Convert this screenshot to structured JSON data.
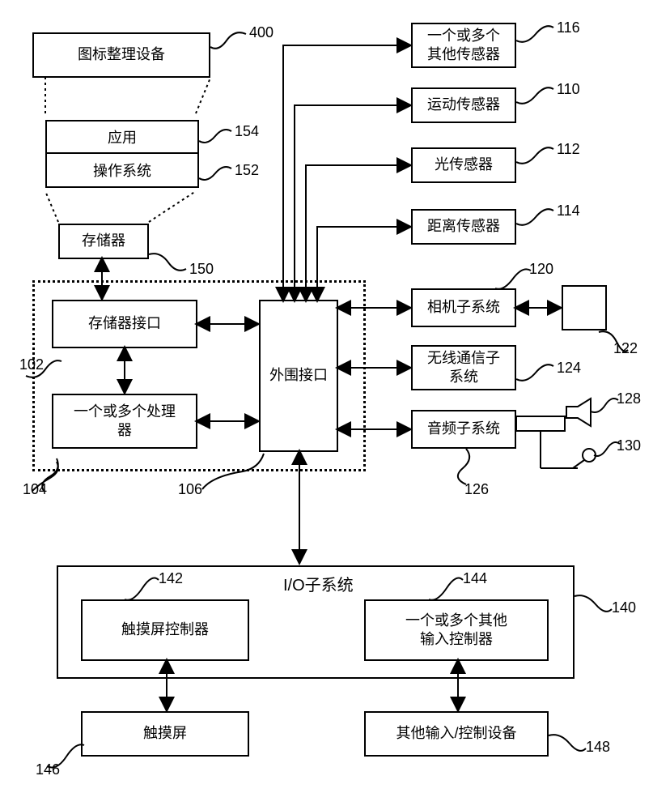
{
  "blocks": {
    "icon_organizer": {
      "label": "图标整理设备",
      "ref": "400"
    },
    "application": {
      "label": "应用",
      "ref": "154"
    },
    "os": {
      "label": "操作系统",
      "ref": "152"
    },
    "memory": {
      "label": "存储器",
      "ref": "150"
    },
    "memory_if": {
      "label": "存储器接口",
      "ref": "102"
    },
    "processors": {
      "label": "一个或多个处理\n器",
      "ref": "104"
    },
    "peripheral_if": {
      "label": "外围接口",
      "ref": "106"
    },
    "other_sensors": {
      "label": "一个或多个\n其他传感器",
      "ref": "116"
    },
    "motion_sensor": {
      "label": "运动传感器",
      "ref": "110"
    },
    "light_sensor": {
      "label": "光传感器",
      "ref": "112"
    },
    "distance_sensor": {
      "label": "距离传感器",
      "ref": "114"
    },
    "camera": {
      "label": "相机子系统",
      "ref": "120"
    },
    "camera_mod": {
      "ref": "122"
    },
    "wireless": {
      "label": "无线通信子\n系统",
      "ref": "124"
    },
    "audio": {
      "label": "音频子系统",
      "ref": "126"
    },
    "speaker": {
      "ref": "128"
    },
    "mic": {
      "ref": "130"
    },
    "io_subsystem": {
      "label": "I/O子系统",
      "ref": "140"
    },
    "touch_ctrl": {
      "label": "触摸屏控制器",
      "ref": "142"
    },
    "other_input_ctrl": {
      "label": "一个或多个其他\n输入控制器",
      "ref": "144"
    },
    "touchscreen": {
      "label": "触摸屏",
      "ref": "146"
    },
    "other_io": {
      "label": "其他输入/控制设备",
      "ref": "148"
    }
  }
}
